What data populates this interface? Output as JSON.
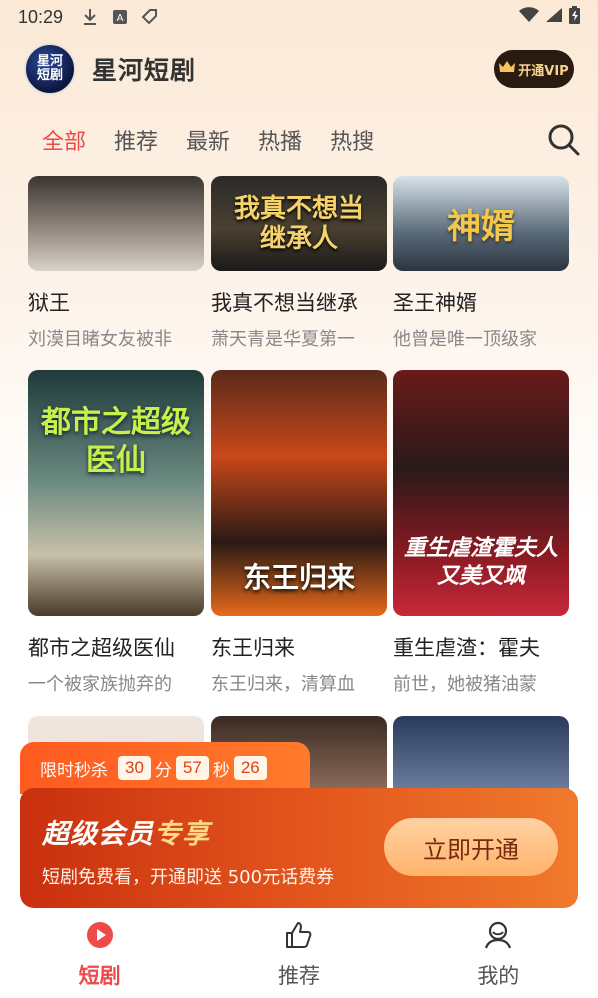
{
  "status_bar": {
    "time": "10:29",
    "icons": [
      "download-icon",
      "a-icon",
      "tag-icon",
      "wifi-icon",
      "signal-icon",
      "battery-icon"
    ]
  },
  "header": {
    "logo_text": "星河短剧",
    "title": "星河短剧",
    "vip_button": "开通VIP"
  },
  "tabs": [
    {
      "label": "全部",
      "active": true
    },
    {
      "label": "推荐",
      "active": false
    },
    {
      "label": "最新",
      "active": false
    },
    {
      "label": "热播",
      "active": false
    },
    {
      "label": "热搜",
      "active": false
    }
  ],
  "dramas": [
    {
      "title": "狱王",
      "desc": "刘漠目睹女友被非",
      "poster_text": ""
    },
    {
      "title": "我真不想当继承",
      "desc": "萧天青是华夏第一",
      "poster_text": "我真不想当继承人"
    },
    {
      "title": "圣王神婿",
      "desc": "他曾是唯一顶级家",
      "poster_text": "神婿"
    },
    {
      "title": "都市之超级医仙",
      "desc": "一个被家族抛弃的",
      "poster_text": "都市之超级医仙"
    },
    {
      "title": "东王归来",
      "desc": "东王归来，清算血",
      "poster_text": "东王归来"
    },
    {
      "title": "重生虐渣：霍夫",
      "desc": "前世，她被猪油蒙",
      "poster_text": "重生虐渣霍夫人又美又飒"
    },
    {
      "title": "",
      "desc": "",
      "poster_text": ""
    },
    {
      "title": "",
      "desc": "",
      "poster_text": ""
    },
    {
      "title": "",
      "desc": "",
      "poster_text": ""
    }
  ],
  "promo": {
    "tag_label": "限时秒杀",
    "countdown": {
      "a": "30",
      "unit_a": "分",
      "b": "57",
      "unit_b": "秒",
      "c": "26"
    },
    "title_main": "超级会员",
    "title_highlight": "专享",
    "subtitle": "短剧免费看，开通即送 500元话费券",
    "button": "立即开通"
  },
  "bottom_nav": [
    {
      "label": "短剧",
      "active": true,
      "icon": "play-icon"
    },
    {
      "label": "推荐",
      "active": false,
      "icon": "thumbs-up-icon"
    },
    {
      "label": "我的",
      "active": false,
      "icon": "user-icon"
    }
  ],
  "colors": {
    "accent": "#ee4a4a",
    "promo_orange": "#e2541c",
    "vip_dark": "#2a1b12"
  }
}
